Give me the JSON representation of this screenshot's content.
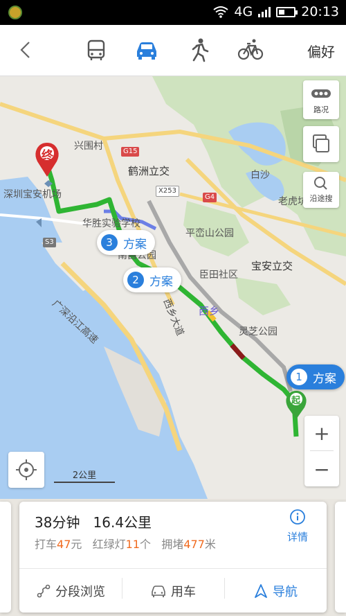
{
  "status_bar": {
    "network": "4G",
    "time": "20:13"
  },
  "top_bar": {
    "modes": [
      "bus",
      "car",
      "walk",
      "bike"
    ],
    "selected_mode": "car",
    "preference_label": "偏好"
  },
  "map": {
    "labels": {
      "xingweicun": "兴围村",
      "airport": "深圳宝安机场",
      "hezhou": "鹤洲立交",
      "baisha": "白沙",
      "laohukeng": "老虎坑",
      "huasheng": "华胜实验学校",
      "nanchang": "南昌公园",
      "pingluanshan": "平峦山公园",
      "baoan_interchange": "宝安立交",
      "jiantian": "臣田社区",
      "xixiang": "西乡",
      "lingzhi": "灵芝公园",
      "expressway": "广深沿江高速",
      "xixiang_road": "西乡大道",
      "end_marker": "终",
      "start_marker": "起"
    },
    "road_badges": {
      "g15": "G15",
      "g4": "G4",
      "x253": "X253",
      "s3": "S3"
    },
    "controls": {
      "traffic_label": "路况",
      "search_along_label": "沿途搜",
      "zoom_in": "+",
      "zoom_out": "−"
    },
    "scale_label": "2公里",
    "route_bubbles": [
      {
        "number": "1",
        "label": "方案",
        "selected": true
      },
      {
        "number": "2",
        "label": "方案",
        "selected": false
      },
      {
        "number": "3",
        "label": "方案",
        "selected": false
      }
    ]
  },
  "route_card": {
    "duration": "38分钟",
    "distance": "16.4公里",
    "taxi_prefix": "打车",
    "taxi_value": "47",
    "taxi_unit": "元",
    "lights_prefix": "红绿灯",
    "lights_value": "11",
    "lights_unit": "个",
    "jam_prefix": "拥堵",
    "jam_value": "477",
    "jam_unit": "米",
    "detail_label": "详情",
    "actions": {
      "segments": "分段浏览",
      "use_car": "用车",
      "navigate": "导航"
    }
  },
  "colors": {
    "accent": "#2a7fdc",
    "highlight": "#f06a1e",
    "route_green": "#2fb533",
    "route_red": "#8b1b1b"
  }
}
